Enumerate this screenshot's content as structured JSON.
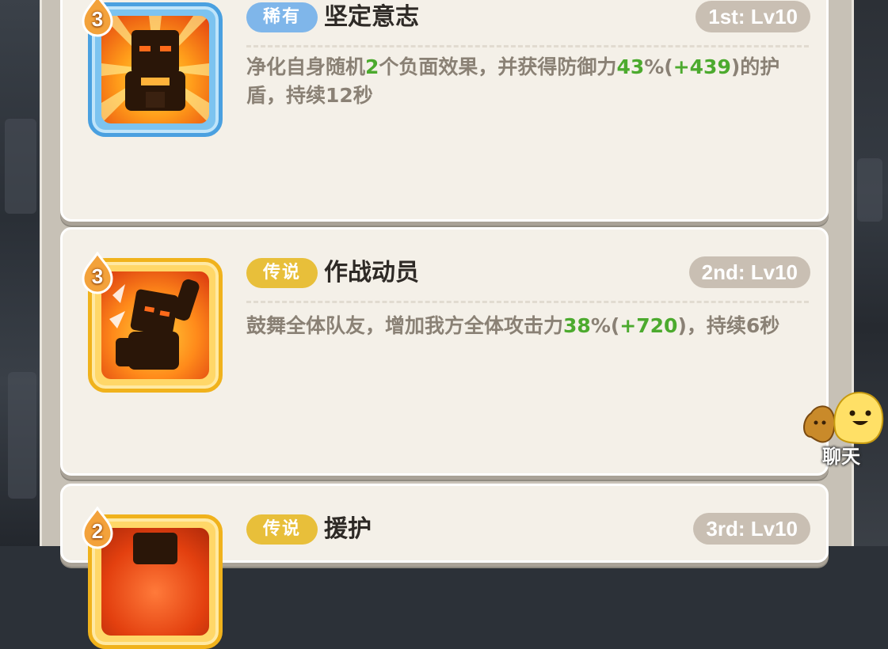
{
  "skills": [
    {
      "level": "3",
      "rarity": "稀有",
      "name": "坚定意志",
      "rank": "1st: Lv10",
      "icon": "shield-guard-icon",
      "description": {
        "p1": "净化自身随机",
        "v1": "2",
        "p2": "个负面效果，并获得防御力",
        "v2": "43",
        "p3": "%(",
        "v3": "+439",
        "p4": ")的护盾，持续12秒"
      }
    },
    {
      "level": "3",
      "rarity": "传说",
      "name": "作战动员",
      "rank": "2nd: Lv10",
      "icon": "battle-cry-icon",
      "description": {
        "p1": "鼓舞全体队友，增加我方全体攻击力",
        "v1": "38",
        "p2": "%(",
        "v2": "+720",
        "p3": ")，持续6秒"
      }
    },
    {
      "level": "2",
      "rarity": "传说",
      "name": "援护",
      "rank": "3rd: Lv10",
      "icon": "cover-icon"
    }
  ],
  "chat": {
    "label": "聊天",
    "icon": "chat-blob-icon"
  },
  "colors": {
    "rare_badge": "#7fb6ea",
    "legend_badge": "#e8bf3a",
    "highlight_value": "#4caa2e",
    "rank_badge": "#c9bfb3"
  }
}
